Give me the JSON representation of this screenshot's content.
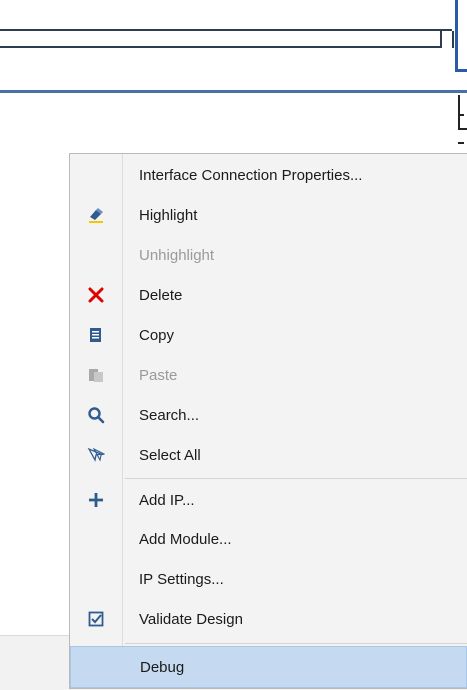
{
  "menu": {
    "items": [
      {
        "label": "Interface Connection Properties...",
        "icon": "none",
        "enabled": true
      },
      {
        "label": "Highlight",
        "icon": "highlight-icon",
        "enabled": true
      },
      {
        "label": "Unhighlight",
        "icon": "none",
        "enabled": false
      },
      {
        "label": "Delete",
        "icon": "delete-icon",
        "enabled": true
      },
      {
        "label": "Copy",
        "icon": "copy-icon",
        "enabled": true
      },
      {
        "label": "Paste",
        "icon": "paste-icon",
        "enabled": false
      },
      {
        "label": "Search...",
        "icon": "search-icon",
        "enabled": true
      },
      {
        "label": "Select All",
        "icon": "select-all-icon",
        "enabled": true
      },
      {
        "label": "Add IP...",
        "icon": "add-icon",
        "enabled": true
      },
      {
        "label": "Add Module...",
        "icon": "none",
        "enabled": true
      },
      {
        "label": "IP Settings...",
        "icon": "none",
        "enabled": true
      },
      {
        "label": "Validate Design",
        "icon": "validate-icon",
        "enabled": true
      },
      {
        "label": "Debug",
        "icon": "none",
        "enabled": true,
        "selected": true
      }
    ]
  },
  "colors": {
    "menu_bg": "#f3f3f3",
    "selected_bg": "#c5d9f1",
    "delete_red": "#e00000",
    "icon_blue": "#2f5b8f",
    "wire_blue": "#4a6fa5"
  }
}
